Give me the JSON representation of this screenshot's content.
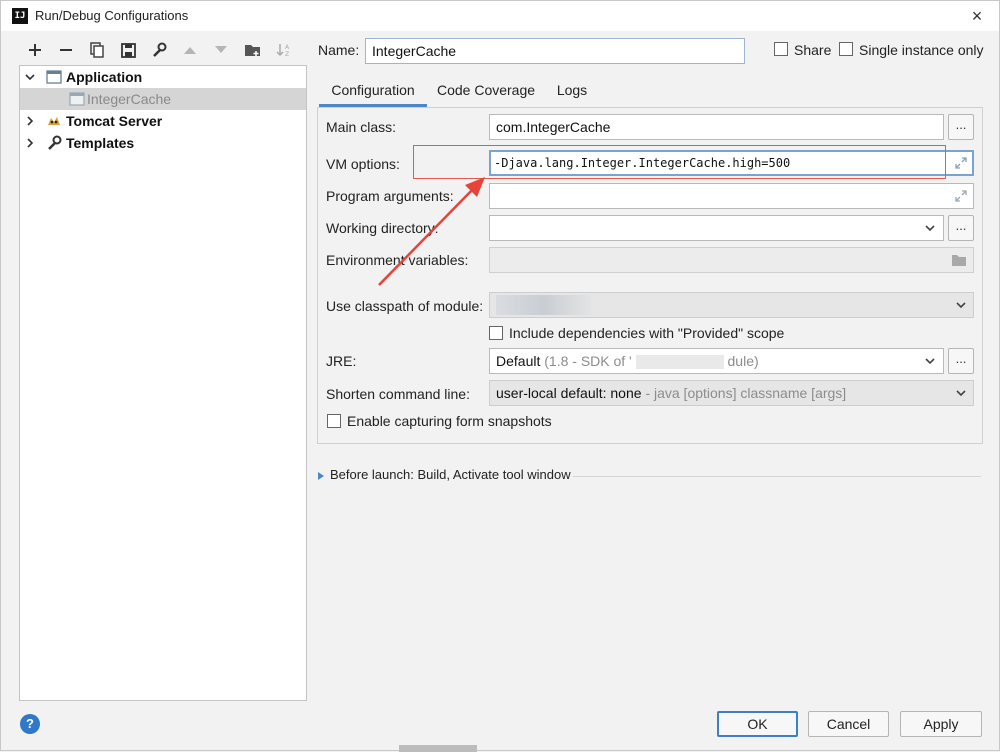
{
  "window": {
    "title": "Run/Debug Configurations",
    "logo_text": "IJ",
    "close_glyph": "×"
  },
  "toolbar": {
    "buttons": [
      "add-icon",
      "remove-icon",
      "copy-icon",
      "save-icon",
      "wrench-icon",
      "move-up-icon",
      "move-down-icon",
      "folder-icon",
      "sort-icon"
    ]
  },
  "tree": {
    "items": [
      {
        "label": "Application",
        "expanded": true,
        "icon": "application-icon"
      },
      {
        "label": "IntegerCache",
        "selected": true,
        "icon": "class-config-icon"
      },
      {
        "label": "Tomcat Server",
        "expanded": false,
        "icon": "tomcat-icon"
      },
      {
        "label": "Templates",
        "expanded": false,
        "icon": "wrench-icon"
      }
    ]
  },
  "header": {
    "name_label": "Name:",
    "name_value": "IntegerCache",
    "share_label": "Share",
    "share_checked": false,
    "single_instance_label": "Single instance only",
    "single_instance_checked": false
  },
  "tabs": [
    {
      "label": "Configuration",
      "active": true
    },
    {
      "label": "Code Coverage",
      "active": false
    },
    {
      "label": "Logs",
      "active": false
    }
  ],
  "form": {
    "main_class_label": "Main class:",
    "main_class_value": "com.IntegerCache",
    "vm_options_label": "VM options:",
    "vm_options_value": "-Djava.lang.Integer.IntegerCache.high=500",
    "program_args_label": "Program arguments:",
    "program_args_value": "",
    "working_dir_label": "Working directory:",
    "working_dir_value": "",
    "env_vars_label": "Environment variables:",
    "env_vars_value": "",
    "classpath_label": "Use classpath of module:",
    "classpath_value": "",
    "include_deps_label": "Include dependencies with \"Provided\" scope",
    "include_deps_checked": false,
    "jre_label": "JRE:",
    "jre_value_prefix": "Default",
    "jre_value_muted_a": "(1.8 - SDK of '",
    "jre_value_muted_b": "dule)",
    "shorten_label": "Shorten command line:",
    "shorten_value": "user-local default: none",
    "shorten_muted": "- java [options] classname [args]",
    "snapshots_label": "Enable capturing form snapshots",
    "snapshots_checked": false,
    "dots": "..."
  },
  "before_launch": {
    "label": "Before launch: Build, Activate tool window"
  },
  "footer": {
    "help_glyph": "?",
    "ok_label": "OK",
    "cancel_label": "Cancel",
    "apply_label": "Apply"
  },
  "colors": {
    "accent": "#4a88c7",
    "annotation_red": "#e8433a",
    "help_blue": "#2f79c8",
    "selection": "#d5d5d5"
  }
}
